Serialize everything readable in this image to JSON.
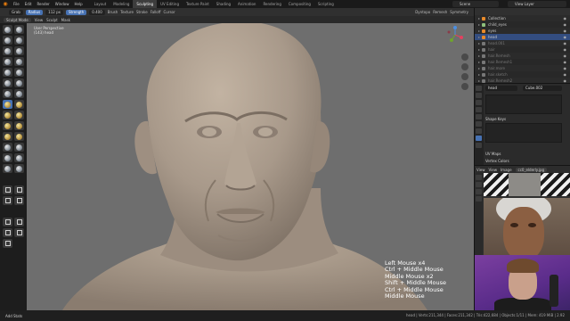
{
  "menubar": {
    "menus": [
      "File",
      "Edit",
      "Render",
      "Window",
      "Help"
    ],
    "workspaces": [
      "Layout",
      "Modeling",
      "Sculpting",
      "UV Editing",
      "Texture Paint",
      "Shading",
      "Animation",
      "Rendering",
      "Compositing",
      "Scripting"
    ],
    "active_workspace": "Sculpting",
    "scene": "Scene",
    "view_layer": "View Layer"
  },
  "tool_settings": {
    "brush": "Grab",
    "radius_label": "Radius",
    "radius_value": "112 px",
    "strength_label": "Strength",
    "strength_value": "0.400",
    "brush_menu": "Brush",
    "texture_menu": "Texture",
    "stroke_menu": "Stroke",
    "falloff_menu": "Falloff",
    "cursor_menu": "Cursor",
    "dyntopo": "Dyntopo",
    "remesh": "Remesh",
    "symmetry": "Symmetry"
  },
  "header": {
    "mode": "Sculpt Mode",
    "items": [
      "View",
      "Sculpt",
      "Mask"
    ]
  },
  "viewport": {
    "perspective": "User Perspective",
    "object_label": "(143) head",
    "key_overlay": [
      "Left Mouse x4",
      "Ctrl + Middle Mouse",
      "Middle Mouse x2",
      "Shift + Middle Mouse",
      "Ctrl + Middle Mouse",
      "Middle Mouse"
    ]
  },
  "outliner": {
    "rows": [
      {
        "label": "Collection",
        "state": "normal"
      },
      {
        "label": "child_eyes",
        "state": "normal"
      },
      {
        "label": "eyes",
        "state": "normal"
      },
      {
        "label": "head",
        "state": "selected"
      },
      {
        "label": "head.001",
        "state": "dim"
      },
      {
        "label": "hair",
        "state": "dim"
      },
      {
        "label": "hair.Remesh",
        "state": "dim"
      },
      {
        "label": "hair.Remesh1",
        "state": "dim"
      },
      {
        "label": "hair.more",
        "state": "dim"
      },
      {
        "label": "hair.sketch",
        "state": "dim"
      },
      {
        "label": "hair.Remesh2",
        "state": "dim"
      }
    ]
  },
  "properties": {
    "object_name": "head",
    "mesh_name": "Cube.002",
    "shape_keys": "Shape Keys",
    "uv_maps": "UV Maps",
    "vertex_colors": "Vertex Colors"
  },
  "image_editor": {
    "view": "View",
    "view_menu": "View",
    "image_menu": "Image",
    "file": "cc0_elderly.jpg"
  },
  "statusbar": {
    "left": "Add Stats",
    "right": "head | Verts:211,344 | Faces:211,342 | Tris:422,684 | Objects:1/11 | Mem: 419 MiB | 2.92"
  },
  "colors": {
    "accent": "#4772b3",
    "viewport_bg": "#6e6e6e",
    "clay": "#a89a8a",
    "blender_orange": "#e87d0d"
  }
}
